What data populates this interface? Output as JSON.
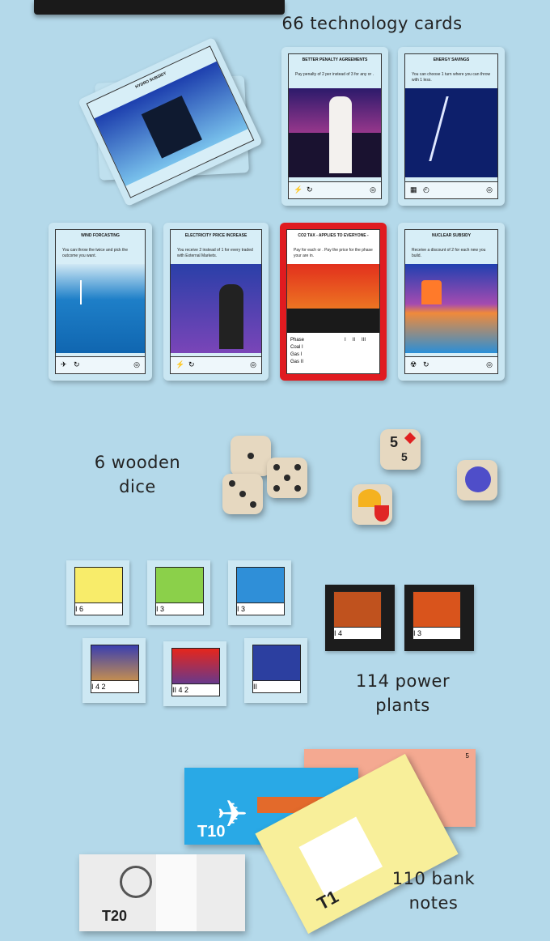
{
  "captions": {
    "tech_cards": "66 technology cards",
    "dice_line1": "6 wooden",
    "dice_line2": "dice",
    "plants_line1": "114 power",
    "plants_line2": "plants",
    "notes_line1": "110 bank",
    "notes_line2": "notes"
  },
  "cards": [
    {
      "title": "BETTER PENALTY AGREEMENTS",
      "text": "Pay penalty of 2 per instead of 3 for any or ."
    },
    {
      "title": "ENERGY SAVINGS",
      "text": "You can choose 1 turn where you can throw with 1 less."
    },
    {
      "title": "WIND FORCASTING",
      "text": "You can throw the twice and pick the outcome you want."
    },
    {
      "title": "ELECTRICITY PRICE INCREASE",
      "text": "You receive 2 instead of 1 for every traded with External Markets."
    },
    {
      "title": "CO2 TAX - APPLIES TO EVERYONE -",
      "text": "Pay for each or . Pay the price for the phase your are in."
    },
    {
      "title": "NUCLEAR SUBSIDY",
      "text": "Receive a discount of 2 for each new you build."
    },
    {
      "title": "HYDRO SUBSIDY",
      "text": "Receive a discount of 1 for each new you build."
    }
  ],
  "co2_table": {
    "header": [
      "Phase",
      "I",
      "II",
      "III"
    ],
    "rows": [
      [
        "Coal",
        "I"
      ],
      [
        "Gas",
        "I"
      ],
      [
        "Gas",
        "II"
      ]
    ]
  },
  "plants": [
    {
      "label": "I 6"
    },
    {
      "label": "I 3"
    },
    {
      "label": "I 3"
    },
    {
      "label": "I 4 2"
    },
    {
      "label": "II 4 2"
    },
    {
      "label": "II"
    },
    {
      "label": "I 4"
    },
    {
      "label": "I 3"
    }
  ],
  "notes": [
    {
      "value": "T10"
    },
    {
      "value": "T1"
    },
    {
      "value": "T20"
    },
    {
      "value": "5"
    }
  ],
  "dice_faces": [
    "5",
    "5"
  ]
}
